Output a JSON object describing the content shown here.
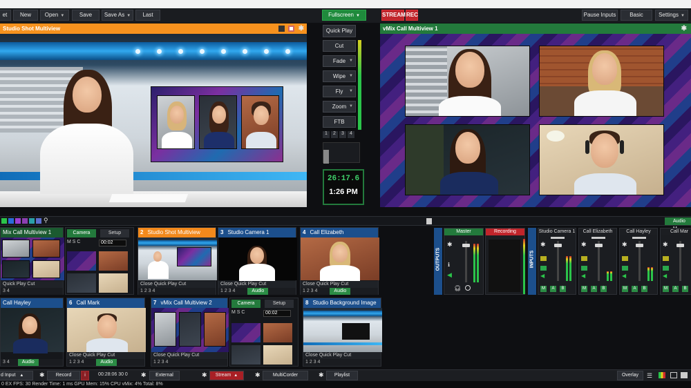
{
  "topbar": {
    "preset_label": "et",
    "new_label": "New",
    "open_label": "Open",
    "save_label": "Save",
    "saveas_label": "Save As",
    "last_label": "Last",
    "fullscreen_label": "Fullscreen",
    "stream_label": "STREAM",
    "rec_label": "REC",
    "pause_inputs_label": "Pause Inputs",
    "basic_label": "Basic",
    "settings_label": "Settings"
  },
  "preview": {
    "title": "Studio Shot Multiview"
  },
  "output": {
    "title": "vMix Call Multiview 1"
  },
  "transitions": {
    "quickplay": "Quick Play",
    "cut": "Cut",
    "fade": "Fade",
    "wipe": "Wipe",
    "fly": "Fly",
    "zoom": "Zoom",
    "ftb": "FTB",
    "numbers": [
      "1",
      "2",
      "3",
      "4"
    ]
  },
  "clock": {
    "timer": "26:17.6",
    "time": "1:26 PM"
  },
  "inputs": [
    {
      "num": "",
      "name": "Mix Call Multiview 1",
      "controls": "Quick Play   Cut",
      "nums": "3   4"
    },
    {
      "num": "",
      "name": "Camera",
      "setup": "Setup",
      "mode": "M  S  C",
      "tc": "00:02"
    },
    {
      "num": "2",
      "name": "Studio Shot Multiview",
      "controls": "Close   Quick Play   Cut",
      "nums": "1   2   3   4"
    },
    {
      "num": "3",
      "name": "Studio Camera 1",
      "controls": "Close   Quick Play   Cut",
      "nums": "1   2   3   4",
      "audio": "Audio"
    },
    {
      "num": "4",
      "name": "Call Elizabeth",
      "controls": "Close   Quick Play   Cut",
      "nums": "1   2   3   4",
      "audio": "Audio"
    },
    {
      "num": "",
      "name": "Call Hayley",
      "nums": "3   4",
      "audio": "Audio"
    },
    {
      "num": "6",
      "name": "Call Mark",
      "controls": "Close   Quick Play   Cut",
      "nums": "1   2   3   4",
      "audio": "Audio"
    },
    {
      "num": "7",
      "name": "vMix Call Multiview 2",
      "controls": "Close   Quick Play   Cut",
      "nums": "1   2   3   4"
    },
    {
      "num": "",
      "name": "Camera",
      "setup": "Setup",
      "mode": "M  S  C",
      "tc": "00:02"
    },
    {
      "num": "8",
      "name": "Studio Background Image",
      "controls": "Close   Quick Play   Cut",
      "nums": "1   2   3   4"
    }
  ],
  "audio": {
    "outputs_label": "OUTPUTS",
    "inputs_label": "INPUTS",
    "master_label": "Master",
    "recording_label": "Recording",
    "mixer_label": "Audio M",
    "channels": [
      "Studio Camera 1",
      "Call Elizabeth",
      "Call Hayley",
      "Call Mar"
    ],
    "bus_a": "A",
    "bus_b": "B",
    "bus_m": "M"
  },
  "bottombar": {
    "add_input": "d Input",
    "record": "Record",
    "rec_time": "00:28:06 30 0",
    "external": "External",
    "stream": "Stream",
    "multicorder": "MultiCorder",
    "playlist": "Playlist",
    "overlay": "Overlay"
  },
  "status": {
    "text": "0   EX  FPS: 30  Render Time: 1 ms  GPU Mem: 15%  CPU vMix: 4%  Total: 8%"
  },
  "colors": {
    "accent_orange": "#f7921e",
    "accent_green": "#237a3c",
    "accent_red": "#c0252b",
    "input_blue": "#1c4f8c"
  }
}
